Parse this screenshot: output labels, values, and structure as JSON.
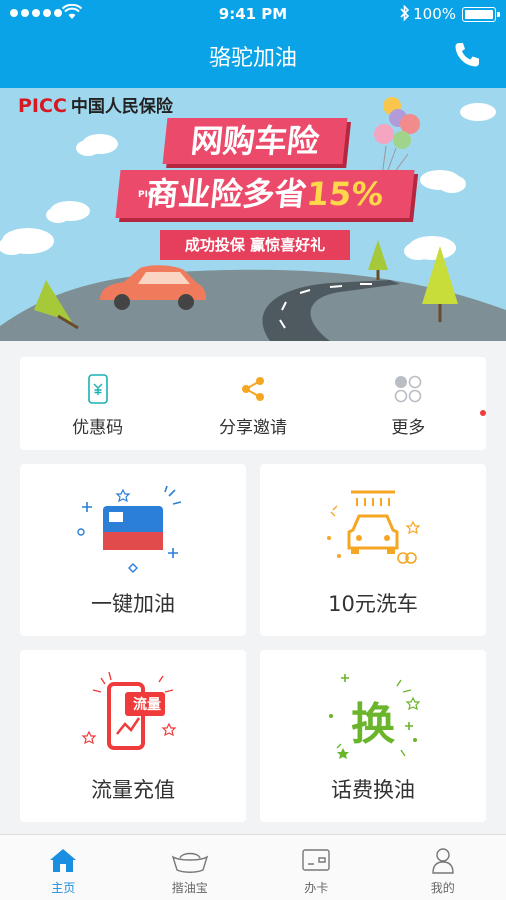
{
  "status_bar": {
    "time": "9:41 PM",
    "battery": "100%"
  },
  "nav": {
    "title": "骆驼加油",
    "phone_icon": "phone-icon"
  },
  "banner": {
    "brand": "PICC",
    "brand_cn": "中国人民保险",
    "line1": "网购车险",
    "line2_prefix": "商业险多省",
    "line2_highlight": "15%",
    "line3": "成功投保  赢惊喜好礼",
    "car_label": "PICC"
  },
  "quick_actions": [
    {
      "label": "优惠码",
      "icon": "coupon-icon"
    },
    {
      "label": "分享邀请",
      "icon": "share-icon"
    },
    {
      "label": "更多",
      "icon": "more-icon"
    }
  ],
  "services": [
    {
      "label": "一键加油",
      "icon": "fuel-card-icon"
    },
    {
      "label": "10元洗车",
      "icon": "car-wash-icon"
    },
    {
      "label": "流量充值",
      "icon": "data-topup-icon",
      "badge": "流量"
    },
    {
      "label": "话费换油",
      "icon": "exchange-icon",
      "badge": "换"
    }
  ],
  "tabs": [
    {
      "label": "主页",
      "icon": "home-icon",
      "active": true
    },
    {
      "label": "揩油宝",
      "icon": "ingot-icon",
      "active": false
    },
    {
      "label": "办卡",
      "icon": "card-icon",
      "active": false
    },
    {
      "label": "我的",
      "icon": "profile-icon",
      "active": false
    }
  ],
  "colors": {
    "primary": "#0aa3e8",
    "banner_red": "#ec4a6a",
    "accent_orange": "#f5a623",
    "accent_red": "#ef3b3b",
    "accent_green": "#6ab52b",
    "tab_active": "#1a8ee0"
  }
}
